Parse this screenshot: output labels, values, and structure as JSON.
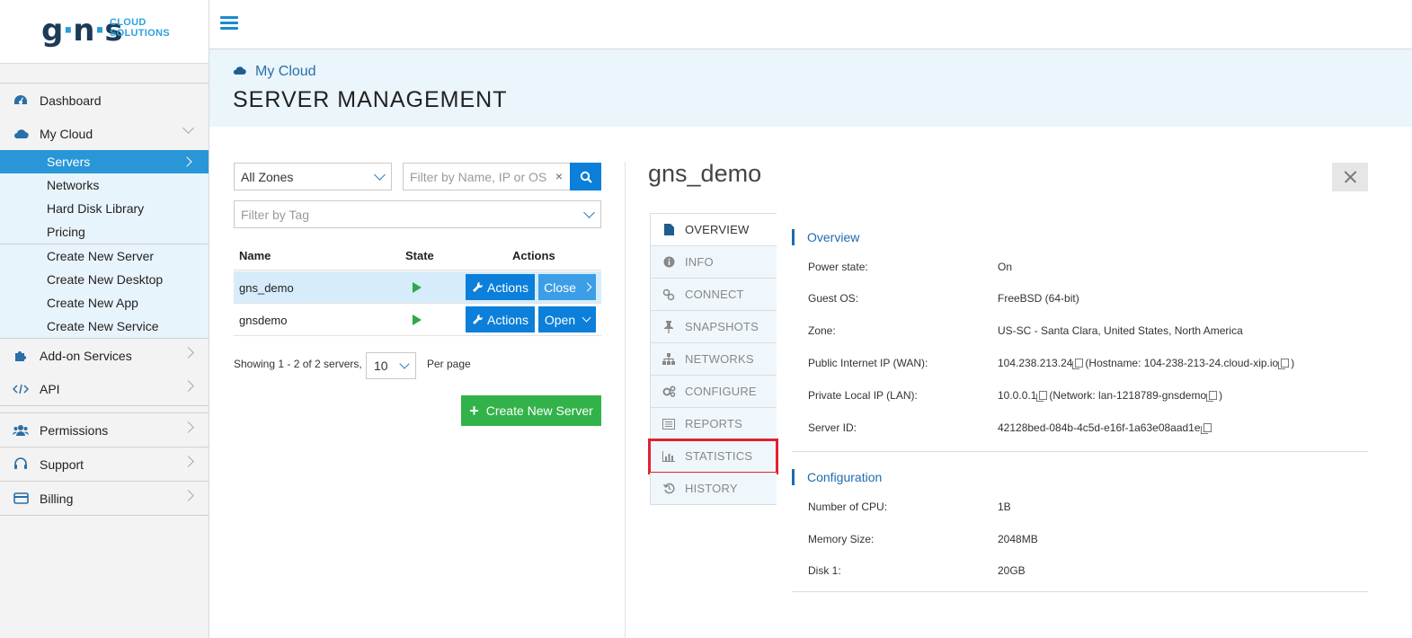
{
  "logo": {
    "mark": "g·n·s",
    "sub_line1": "CLOUD",
    "sub_line2": "SOLUTIONS"
  },
  "sidebar": {
    "items": [
      {
        "label": "Dashboard"
      },
      {
        "label": "My Cloud"
      },
      {
        "label": "Add-on Services"
      },
      {
        "label": "API"
      },
      {
        "label": "Permissions"
      },
      {
        "label": "Support"
      },
      {
        "label": "Billing"
      }
    ],
    "mycloud_sub": [
      "Servers",
      "Networks",
      "Hard Disk Library",
      "Pricing"
    ],
    "mycloud_create": [
      "Create New Server",
      "Create New Desktop",
      "Create New App",
      "Create New Service"
    ]
  },
  "header": {
    "breadcrumb": "My Cloud",
    "title": "SERVER MANAGEMENT"
  },
  "filters": {
    "zone_value": "All Zones",
    "search_placeholder": "Filter by Name, IP or OS",
    "clear": "×",
    "tag_placeholder": "Filter by Tag"
  },
  "table": {
    "headers": {
      "name": "Name",
      "state": "State",
      "actions": "Actions"
    },
    "rows": [
      {
        "name": "gns_demo",
        "action": "Actions",
        "toggle": "Close"
      },
      {
        "name": "gnsdemo",
        "action": "Actions",
        "toggle": "Open"
      }
    ],
    "showing": "Showing 1 - 2 of 2 servers,",
    "per_page_value": "10",
    "per_page_label": "Per page",
    "create_button": "Create New Server"
  },
  "detail": {
    "server_name": "gns_demo",
    "tabs": [
      "OVERVIEW",
      "INFO",
      "CONNECT",
      "SNAPSHOTS",
      "NETWORKS",
      "CONFIGURE",
      "REPORTS",
      "STATISTICS",
      "HISTORY"
    ],
    "overview": {
      "heading": "Overview",
      "rows": [
        {
          "label": "Power state:",
          "value": "On"
        },
        {
          "label": "Guest OS:",
          "value": "FreeBSD (64-bit)"
        },
        {
          "label": "Zone:",
          "value": "US-SC - Santa Clara, United States, North America"
        },
        {
          "label": "Public Internet IP (WAN):",
          "value": "104.238.213.24",
          "extra": "(Hostname: 104-238-213-24.cloud-xip.io",
          "close": ")"
        },
        {
          "label": "Private Local IP (LAN):",
          "value": "10.0.0.1",
          "extra": "(Network: lan-1218789-gnsdemo",
          "close": ")"
        },
        {
          "label": "Server ID:",
          "value": "42128bed-084b-4c5d-e16f-1a63e08aad1e"
        }
      ]
    },
    "configuration": {
      "heading": "Configuration",
      "rows": [
        {
          "label": "Number of CPU:",
          "value": "1B"
        },
        {
          "label": "Memory Size:",
          "value": "2048MB"
        },
        {
          "label": "Disk 1:",
          "value": "20GB"
        }
      ]
    }
  },
  "colors": {
    "accent": "#0b7fd9",
    "sidebar_active": "#2997d7",
    "create": "#32b34a",
    "highlight": "#e0232e"
  }
}
